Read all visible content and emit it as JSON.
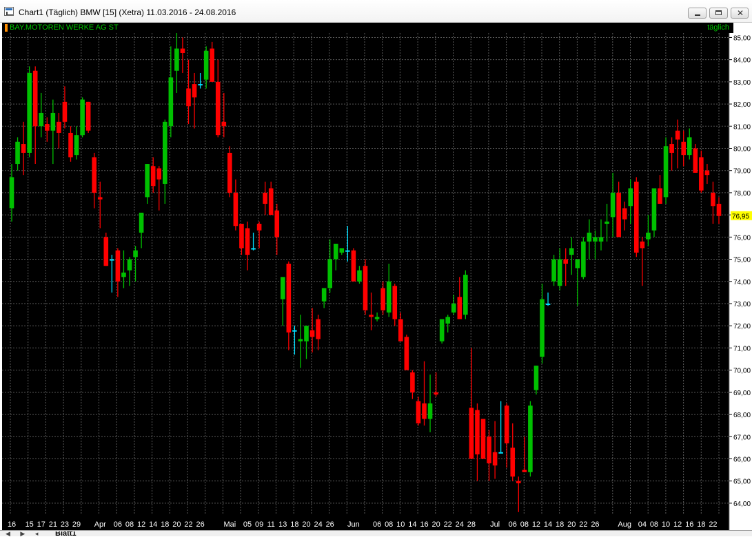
{
  "window": {
    "title": "Chart1 (Täglich)  BMW [15] (Xetra) 11.03.2016 - 24.08.2016",
    "min_icon": "minimize-icon",
    "max_icon": "maximize-icon",
    "close_icon": "close-icon",
    "close_glyph": "✕"
  },
  "header": {
    "symbol": "BAY.MOTOREN WERKE AG ST",
    "period": "täglich"
  },
  "tabs": {
    "sheet": "Blatt1",
    "nav": "◀ ▶ ◂"
  },
  "colors": {
    "background": "#000000",
    "grid": "#5a5a5a",
    "up": "#00c000",
    "down": "#ff0000",
    "flat": "#00e0ff",
    "axis_text": "#ffffff",
    "last_price_bg": "#ffff00"
  },
  "chart_data": {
    "type": "candlestick",
    "instrument": "BMW [15] (Xetra)",
    "date_range": [
      "11.03.2016",
      "24.08.2016"
    ],
    "ylim": [
      63.5,
      85.2
    ],
    "y_ticks": [
      "64,00",
      "65,00",
      "66,00",
      "67,00",
      "68,00",
      "69,00",
      "70,00",
      "71,00",
      "72,00",
      "73,00",
      "74,00",
      "75,00",
      "76,00",
      "77,00",
      "78,00",
      "79,00",
      "80,00",
      "81,00",
      "82,00",
      "83,00",
      "84,00",
      "85,00"
    ],
    "last_price": "76,95",
    "last_value": 76.95,
    "grid": true,
    "x_labels": [
      {
        "label": "16",
        "i": 0
      },
      {
        "label": "15",
        "i": 3
      },
      {
        "label": "17",
        "i": 5
      },
      {
        "label": "21",
        "i": 7
      },
      {
        "label": "23",
        "i": 9
      },
      {
        "label": "29",
        "i": 11
      },
      {
        "label": "Apr",
        "i": 15
      },
      {
        "label": "06",
        "i": 18
      },
      {
        "label": "08",
        "i": 20
      },
      {
        "label": "12",
        "i": 22
      },
      {
        "label": "14",
        "i": 24
      },
      {
        "label": "18",
        "i": 26
      },
      {
        "label": "20",
        "i": 28
      },
      {
        "label": "22",
        "i": 30
      },
      {
        "label": "26",
        "i": 32
      },
      {
        "label": "Mai",
        "i": 37
      },
      {
        "label": "05",
        "i": 40
      },
      {
        "label": "09",
        "i": 42
      },
      {
        "label": "11",
        "i": 44
      },
      {
        "label": "13",
        "i": 46
      },
      {
        "label": "18",
        "i": 48
      },
      {
        "label": "20",
        "i": 50
      },
      {
        "label": "24",
        "i": 52
      },
      {
        "label": "26",
        "i": 54
      },
      {
        "label": "Jun",
        "i": 58
      },
      {
        "label": "06",
        "i": 62
      },
      {
        "label": "08",
        "i": 64
      },
      {
        "label": "10",
        "i": 66
      },
      {
        "label": "14",
        "i": 68
      },
      {
        "label": "16",
        "i": 70
      },
      {
        "label": "20",
        "i": 72
      },
      {
        "label": "22",
        "i": 74
      },
      {
        "label": "24",
        "i": 76
      },
      {
        "label": "28",
        "i": 78
      },
      {
        "label": "Jul",
        "i": 82
      },
      {
        "label": "06",
        "i": 85
      },
      {
        "label": "08",
        "i": 87
      },
      {
        "label": "12",
        "i": 89
      },
      {
        "label": "14",
        "i": 91
      },
      {
        "label": "18",
        "i": 93
      },
      {
        "label": "20",
        "i": 95
      },
      {
        "label": "22",
        "i": 97
      },
      {
        "label": "26",
        "i": 99
      },
      {
        "label": "Aug",
        "i": 104
      },
      {
        "label": "04",
        "i": 107
      },
      {
        "label": "08",
        "i": 109
      },
      {
        "label": "10",
        "i": 111
      },
      {
        "label": "12",
        "i": 113
      },
      {
        "label": "16",
        "i": 115
      },
      {
        "label": "18",
        "i": 117
      },
      {
        "label": "22",
        "i": 119
      }
    ],
    "candles": [
      [
        77.3,
        79.3,
        76.7,
        78.7
      ],
      [
        79.3,
        80.5,
        79.0,
        80.3
      ],
      [
        80.2,
        81.2,
        78.8,
        79.8
      ],
      [
        79.8,
        83.7,
        79.6,
        83.4
      ],
      [
        83.5,
        83.7,
        79.3,
        81.0
      ],
      [
        81.0,
        82.5,
        80.5,
        81.6
      ],
      [
        81.1,
        81.4,
        80.3,
        80.8
      ],
      [
        80.8,
        82.2,
        79.3,
        81.6
      ],
      [
        81.2,
        81.6,
        80.0,
        80.7
      ],
      [
        82.1,
        82.8,
        80.9,
        81.2
      ],
      [
        80.7,
        81.0,
        79.4,
        79.6
      ],
      [
        79.7,
        81.0,
        79.5,
        80.6
      ],
      [
        80.6,
        82.3,
        80.5,
        82.2
      ],
      [
        82.1,
        82.1,
        80.7,
        80.8
      ],
      [
        79.6,
        79.8,
        77.3,
        78.0
      ],
      [
        77.8,
        78.5,
        76.4,
        77.7
      ],
      [
        76.0,
        76.2,
        74.7,
        74.7
      ],
      [
        75.0,
        75.2,
        73.5,
        75.0
      ],
      [
        75.4,
        75.5,
        73.3,
        74.0
      ],
      [
        74.2,
        75.4,
        73.7,
        74.4
      ],
      [
        74.5,
        75.1,
        73.8,
        75.0
      ],
      [
        75.1,
        75.6,
        74.0,
        75.4
      ],
      [
        76.2,
        77.0,
        75.5,
        77.1
      ],
      [
        77.8,
        79.3,
        77.5,
        79.3
      ],
      [
        79.2,
        79.6,
        78.0,
        78.3
      ],
      [
        79.1,
        79.2,
        77.2,
        78.6
      ],
      [
        78.4,
        81.3,
        77.5,
        81.2
      ],
      [
        81.0,
        84.6,
        80.5,
        83.2
      ],
      [
        83.5,
        85.2,
        82.5,
        84.5
      ],
      [
        84.5,
        85.0,
        83.4,
        84.3
      ],
      [
        82.7,
        84.0,
        81.1,
        81.9
      ],
      [
        82.9,
        83.4,
        80.9,
        82.3
      ],
      [
        82.9,
        83.4,
        82.7,
        82.9
      ],
      [
        83.1,
        84.6,
        82.7,
        84.4
      ],
      [
        84.5,
        84.8,
        83.0,
        83.0
      ],
      [
        83.0,
        84.0,
        80.5,
        80.6
      ],
      [
        81.2,
        82.5,
        80.5,
        81.0
      ],
      [
        79.8,
        80.1,
        77.8,
        78.0
      ],
      [
        78.0,
        78.6,
        76.3,
        76.5
      ],
      [
        76.6,
        76.6,
        75.2,
        75.5
      ],
      [
        76.4,
        76.7,
        74.5,
        75.2
      ],
      [
        75.5,
        76.2,
        75.4,
        75.5
      ],
      [
        76.6,
        76.7,
        75.5,
        76.3
      ],
      [
        78.0,
        78.5,
        77.0,
        77.5
      ],
      [
        78.2,
        78.5,
        77.3,
        77.0
      ],
      [
        77.2,
        77.5,
        75.2,
        76.0
      ],
      [
        73.2,
        74.0,
        72.0,
        74.2
      ],
      [
        74.8,
        74.9,
        70.9,
        71.7
      ],
      [
        71.8,
        72.0,
        70.7,
        71.8
      ],
      [
        71.3,
        72.5,
        70.1,
        71.4
      ],
      [
        71.3,
        72.0,
        70.5,
        72.0
      ],
      [
        71.8,
        72.8,
        70.8,
        71.5
      ],
      [
        72.3,
        72.5,
        70.9,
        71.4
      ],
      [
        73.1,
        73.7,
        72.8,
        73.7
      ],
      [
        73.7,
        75.9,
        73.5,
        75.0
      ],
      [
        75.0,
        75.6,
        74.5,
        75.7
      ],
      [
        75.3,
        75.5,
        75.2,
        75.5
      ],
      [
        75.4,
        76.5,
        74.9,
        75.4
      ],
      [
        75.4,
        75.5,
        74.0,
        74.0
      ],
      [
        74.0,
        74.7,
        73.9,
        74.5
      ],
      [
        74.7,
        75.0,
        72.5,
        72.7
      ],
      [
        72.5,
        73.5,
        71.8,
        72.4
      ],
      [
        72.3,
        72.6,
        72.2,
        72.4
      ],
      [
        73.7,
        74.0,
        72.5,
        72.7
      ],
      [
        72.6,
        74.8,
        72.4,
        74.0
      ],
      [
        73.8,
        73.9,
        72.0,
        72.3
      ],
      [
        72.3,
        72.6,
        71.3,
        71.3
      ],
      [
        71.5,
        71.6,
        70.1,
        70.0
      ],
      [
        69.9,
        70.0,
        68.7,
        69.0
      ],
      [
        68.6,
        68.8,
        67.5,
        67.6
      ],
      [
        68.5,
        70.4,
        67.5,
        67.8
      ],
      [
        67.8,
        69.8,
        67.2,
        68.5
      ],
      [
        69.0,
        69.9,
        68.8,
        68.9
      ],
      [
        71.3,
        72.0,
        71.2,
        72.3
      ],
      [
        72.1,
        72.5,
        71.7,
        72.4
      ],
      [
        72.6,
        73.4,
        72.5,
        73.0
      ],
      [
        73.3,
        74.2,
        72.5,
        72.3
      ],
      [
        72.5,
        74.5,
        72.3,
        74.3
      ],
      [
        68.3,
        71.0,
        66.0,
        66.0
      ],
      [
        68.2,
        68.5,
        65.0,
        66.2
      ],
      [
        67.8,
        67.8,
        66.0,
        66.0
      ],
      [
        67.0,
        67.3,
        65.0,
        65.8
      ],
      [
        66.3,
        67.7,
        65.1,
        65.7
      ],
      [
        66.3,
        68.6,
        66.3,
        66.3
      ],
      [
        68.4,
        68.5,
        65.6,
        66.7
      ],
      [
        66.5,
        67.6,
        65.0,
        65.2
      ],
      [
        65.0,
        65.2,
        63.6,
        64.9
      ],
      [
        65.5,
        67.0,
        65.4,
        65.4
      ],
      [
        65.4,
        68.6,
        65.2,
        68.4
      ],
      [
        69.1,
        70.2,
        68.9,
        70.2
      ],
      [
        70.6,
        73.9,
        70.3,
        73.2
      ],
      [
        73.0,
        73.5,
        72.9,
        73.0
      ],
      [
        74.0,
        75.2,
        73.8,
        75.0
      ],
      [
        73.8,
        75.5,
        73.6,
        75.0
      ],
      [
        75.0,
        75.5,
        73.8,
        74.8
      ],
      [
        75.2,
        76.0,
        74.3,
        75.5
      ],
      [
        74.6,
        75.0,
        72.9,
        75.0
      ],
      [
        74.2,
        76.0,
        74.1,
        75.8
      ],
      [
        75.8,
        76.8,
        75.0,
        76.2
      ],
      [
        75.8,
        76.3,
        75.0,
        76.0
      ],
      [
        75.8,
        76.8,
        75.4,
        76.0
      ],
      [
        76.6,
        77.5,
        75.8,
        76.7
      ],
      [
        76.9,
        78.9,
        76.0,
        78.0
      ],
      [
        78.0,
        78.5,
        76.0,
        76.0
      ],
      [
        77.3,
        77.6,
        76.3,
        76.8
      ],
      [
        77.4,
        78.6,
        76.6,
        78.2
      ],
      [
        78.5,
        78.7,
        75.1,
        75.3
      ],
      [
        75.8,
        76.0,
        73.8,
        75.5
      ],
      [
        75.9,
        77.0,
        75.6,
        76.2
      ],
      [
        76.3,
        78.0,
        76.0,
        78.2
      ],
      [
        78.2,
        78.8,
        77.5,
        77.5
      ],
      [
        77.8,
        80.5,
        77.5,
        80.1
      ],
      [
        80.2,
        80.5,
        79.0,
        79.8
      ],
      [
        80.8,
        81.3,
        79.1,
        80.4
      ],
      [
        80.3,
        80.8,
        79.2,
        79.7
      ],
      [
        79.7,
        80.9,
        79.5,
        80.5
      ],
      [
        80.0,
        80.2,
        78.9,
        78.9
      ],
      [
        79.6,
        79.9,
        78.0,
        78.1
      ],
      [
        79.0,
        79.3,
        78.4,
        78.8
      ],
      [
        78.0,
        78.5,
        76.6,
        77.4
      ],
      [
        77.5,
        77.8,
        76.6,
        76.95
      ]
    ]
  }
}
